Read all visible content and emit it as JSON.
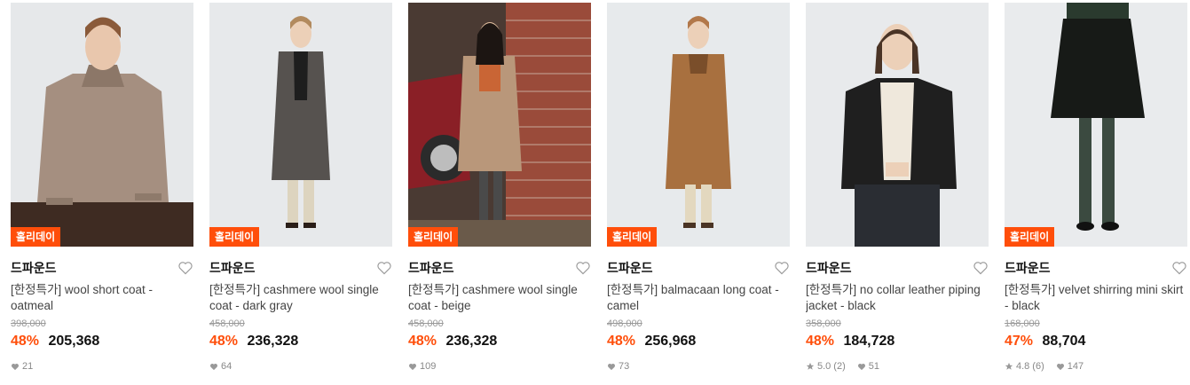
{
  "colors": {
    "accent": "#ff4e0a",
    "muted": "#888888"
  },
  "products": [
    {
      "tag": "홀리데이",
      "brand": "드파운드",
      "name": "[한정특가] wool short coat - oatmeal",
      "original_price": "398,000",
      "discount": "48%",
      "price": "205,368",
      "rating": "",
      "reviews": "",
      "likes": "21"
    },
    {
      "tag": "홀리데이",
      "brand": "드파운드",
      "name": "[한정특가] cashmere wool single coat - dark gray",
      "original_price": "458,000",
      "discount": "48%",
      "price": "236,328",
      "rating": "",
      "reviews": "",
      "likes": "64"
    },
    {
      "tag": "홀리데이",
      "brand": "드파운드",
      "name": "[한정특가] cashmere wool single coat - beige",
      "original_price": "458,000",
      "discount": "48%",
      "price": "236,328",
      "rating": "",
      "reviews": "",
      "likes": "109"
    },
    {
      "tag": "홀리데이",
      "brand": "드파운드",
      "name": "[한정특가] balmacaan long coat - camel",
      "original_price": "498,000",
      "discount": "48%",
      "price": "256,968",
      "rating": "",
      "reviews": "",
      "likes": "73"
    },
    {
      "tag": "",
      "brand": "드파운드",
      "name": "[한정특가] no collar leather piping jacket - black",
      "original_price": "358,000",
      "discount": "48%",
      "price": "184,728",
      "rating": "5.0",
      "reviews": "(2)",
      "likes": "51"
    },
    {
      "tag": "홀리데이",
      "brand": "드파운드",
      "name": "[한정특가] velvet shirring mini skirt - black",
      "original_price": "168,000",
      "discount": "47%",
      "price": "88,704",
      "rating": "4.8",
      "reviews": "(6)",
      "likes": "147"
    }
  ]
}
